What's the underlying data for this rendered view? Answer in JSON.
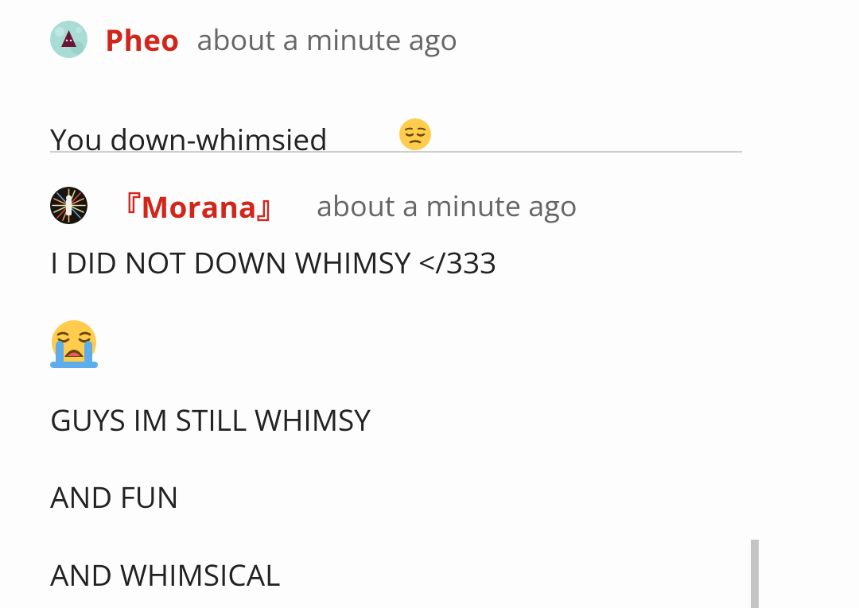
{
  "comments": [
    {
      "username": "Pheo",
      "timestamp": "about a minute ago",
      "avatar_icon": "triangle-avatar-icon",
      "body": "You down-whimsied",
      "body_emoji": "pensive-face-emoji"
    },
    {
      "username": "『Morana』",
      "timestamp": "about a minute ago",
      "avatar_icon": "starburst-avatar-icon",
      "lines": [
        "I DID NOT DOWN WHIMSY </333",
        "GUYS IM STILL WHIMSY",
        "AND FUN",
        "AND WHIMSICAL"
      ],
      "emoji": "loudly-crying-face-emoji"
    }
  ],
  "colors": {
    "username": "#d2261b",
    "timestamp": "#666666",
    "text": "#222222",
    "divider": "#cfcfcf",
    "scrollbar": "#c4c4c4",
    "background": "#fdfdfd"
  }
}
